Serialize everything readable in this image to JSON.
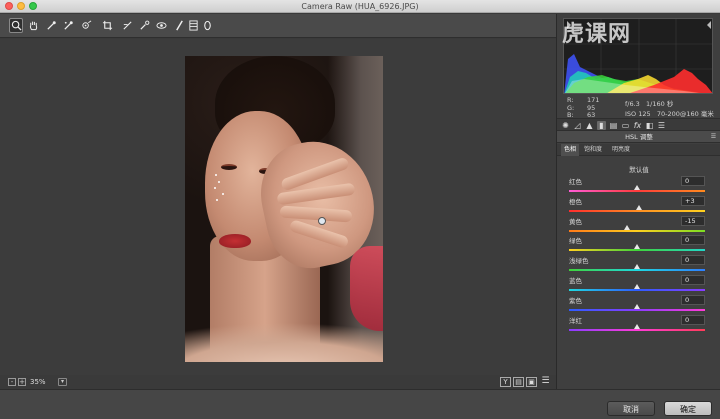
{
  "window": {
    "title": "Camera Raw (HUA_6926.JPG)"
  },
  "toolbar": {
    "tools": [
      {
        "name": "zoom-tool",
        "glyph": "🔍"
      },
      {
        "name": "hand-tool",
        "glyph": "✋"
      },
      {
        "name": "white-balance-tool",
        "glyph": "✎"
      },
      {
        "name": "color-sampler-tool",
        "glyph": "✎"
      },
      {
        "name": "targeted-adjustment-tool",
        "glyph": "◎"
      },
      {
        "name": "crop-tool",
        "glyph": "⌗"
      },
      {
        "name": "straighten-tool",
        "glyph": "⟋"
      },
      {
        "name": "spot-removal-tool",
        "glyph": "✦"
      },
      {
        "name": "red-eye-tool",
        "glyph": "◉"
      },
      {
        "name": "adjustment-brush-tool",
        "glyph": "🖌"
      },
      {
        "name": "graduated-filter-tool",
        "glyph": "▥"
      },
      {
        "name": "radial-filter-tool",
        "glyph": "O"
      }
    ]
  },
  "status": {
    "zoom": "35%",
    "zoom_out": "-",
    "zoom_in": "+",
    "view_y": "Y",
    "view_a": "▤",
    "view_b": "▣"
  },
  "info": {
    "r_label": "R:",
    "r_value": "171",
    "g_label": "G:",
    "g_value": "95",
    "b_label": "B:",
    "b_value": "63",
    "aperture": "f/6.3",
    "shutter": "1/160 秒",
    "iso": "ISO 125",
    "lens": "70-200@160 毫米"
  },
  "panel": {
    "title": "HSL 调整",
    "tabs": [
      "色相",
      "饱和度",
      "明亮度"
    ],
    "default_label": "默认值",
    "sliders": [
      {
        "label": "红色",
        "value": "0",
        "pos": 0.5,
        "gradient": [
          "#ff5bd6",
          "#ff3b3b",
          "#ff8a1e"
        ]
      },
      {
        "label": "橙色",
        "value": "+3",
        "pos": 0.515,
        "gradient": [
          "#ff2d2d",
          "#ff8d22",
          "#ffd21f"
        ]
      },
      {
        "label": "黄色",
        "value": "-15",
        "pos": 0.425,
        "gradient": [
          "#ff7a18",
          "#ffd01f",
          "#7dde23"
        ]
      },
      {
        "label": "绿色",
        "value": "0",
        "pos": 0.5,
        "gradient": [
          "#ffd21f",
          "#3fd43a",
          "#22d6c8"
        ]
      },
      {
        "label": "浅绿色",
        "value": "0",
        "pos": 0.5,
        "gradient": [
          "#3fd43a",
          "#1ed8e0",
          "#2f7fff"
        ]
      },
      {
        "label": "蓝色",
        "value": "0",
        "pos": 0.5,
        "gradient": [
          "#1ed8e0",
          "#2f5cff",
          "#8a3cff"
        ]
      },
      {
        "label": "紫色",
        "value": "0",
        "pos": 0.5,
        "gradient": [
          "#2f5cff",
          "#8a3cff",
          "#ff3bd7"
        ]
      },
      {
        "label": "洋红",
        "value": "0",
        "pos": 0.5,
        "gradient": [
          "#8a3cff",
          "#ff3bd7",
          "#ff3b5a"
        ]
      }
    ]
  },
  "footer": {
    "cancel": "取消",
    "ok": "确定"
  },
  "watermark": "虎课网"
}
